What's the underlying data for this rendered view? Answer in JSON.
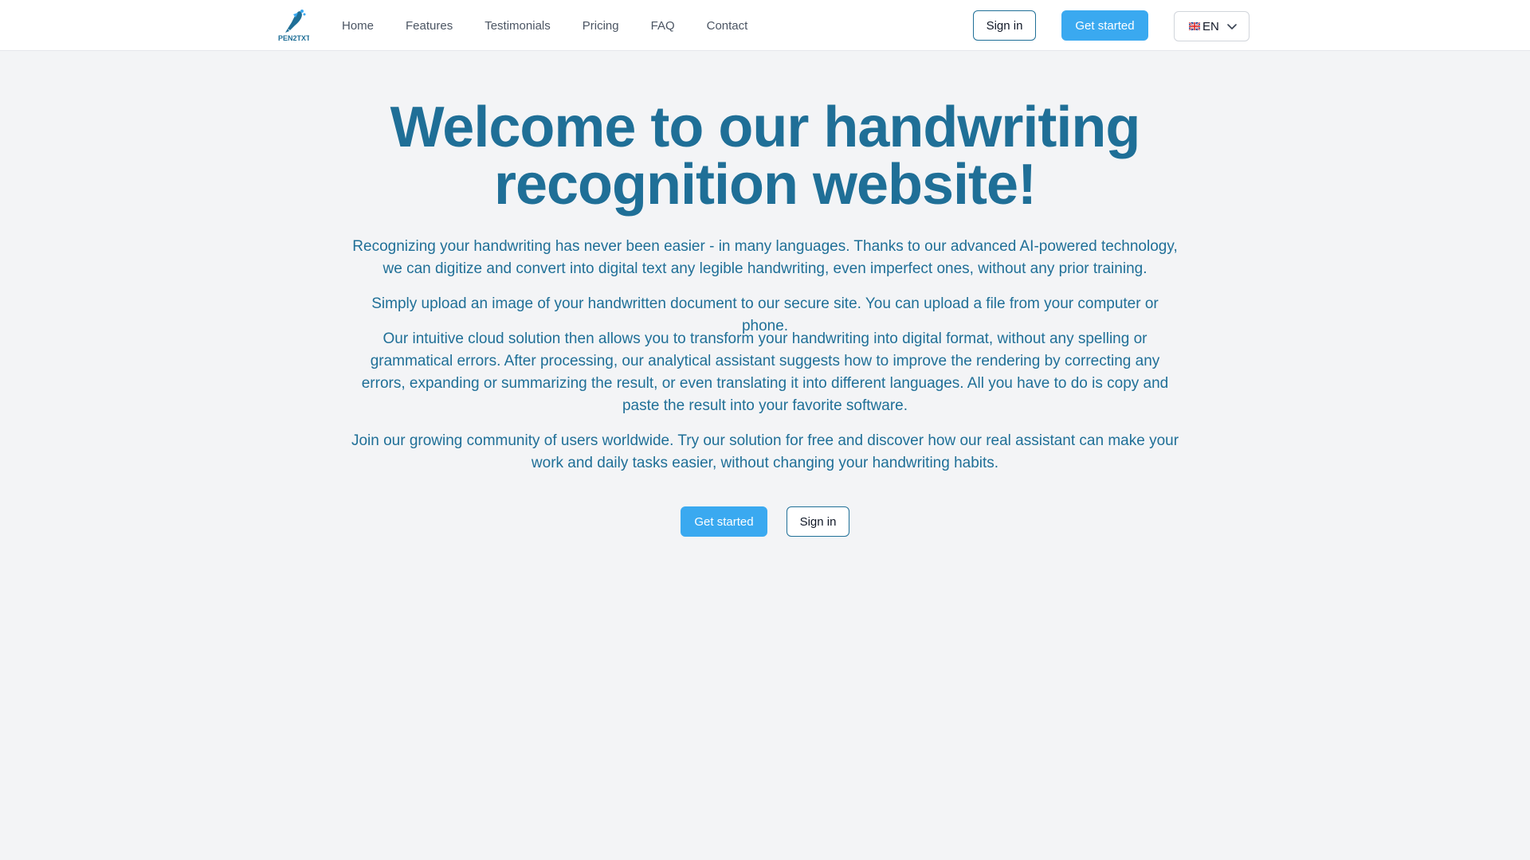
{
  "brand": {
    "logo_icon": "quill-pen-icon",
    "logo_text": "PEN2TXT",
    "color": "#1f6f97"
  },
  "nav": {
    "items": [
      {
        "label": "Home"
      },
      {
        "label": "Features"
      },
      {
        "label": "Testimonials"
      },
      {
        "label": "Pricing"
      },
      {
        "label": "FAQ"
      },
      {
        "label": "Contact"
      }
    ]
  },
  "header_actions": {
    "sign_in": "Sign in",
    "get_started": "Get started",
    "language": "EN",
    "language_icon": "uk-flag-icon",
    "dropdown_icon": "chevron-down-icon"
  },
  "hero": {
    "title": "Welcome to our handwriting recognition website!",
    "paragraphs": [
      "Recognizing your handwriting has never been easier - in many languages. Thanks to our advanced AI-powered technology, we can digitize and convert into digital text any legible handwriting, even imperfect ones, without any prior training.",
      "Simply upload an image of your handwritten document to our secure site. You can upload a file from your computer or phone.",
      "Our intuitive cloud solution then allows you to transform your handwriting into digital format, without any spelling or grammatical errors. After processing, our analytical assistant suggests how to improve the rendering by correcting any errors, expanding or summarizing the result, or even translating it into different languages. All you have to do is copy and paste the result into your favorite software.",
      "Join our growing community of users worldwide. Try our solution for free and discover how our real assistant can make your work and daily tasks easier, without changing your handwriting habits."
    ],
    "cta_primary": "Get started",
    "cta_secondary": "Sign in"
  },
  "colors": {
    "accent": "#3aa9f0",
    "text": "#1f6f97",
    "background": "#f3f4f6"
  }
}
